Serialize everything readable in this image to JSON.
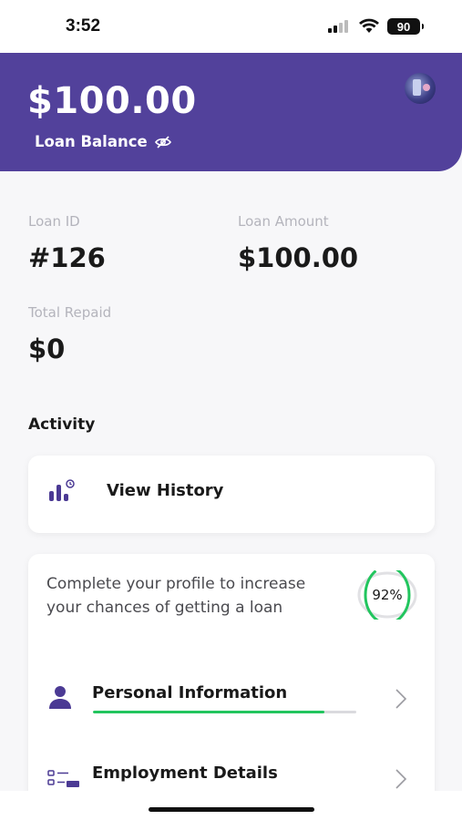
{
  "status_bar": {
    "time": "3:52",
    "battery": "90"
  },
  "header": {
    "balance": "$100.00",
    "balance_label": "Loan Balance"
  },
  "loan": {
    "id_label": "Loan ID",
    "id_value": "#126",
    "amount_label": "Loan Amount",
    "amount_value": "$100.00",
    "repaid_label": "Total Repaid",
    "repaid_value": "$0"
  },
  "activity": {
    "heading": "Activity",
    "history_label": "View History"
  },
  "profile": {
    "message": "Complete your profile to increase your chances of getting a loan",
    "progress_text": "92%",
    "progress_value": 0.92,
    "items": [
      {
        "label": "Personal Information",
        "progress": 0.88,
        "icon": "person-icon"
      },
      {
        "label": "Employment Details",
        "progress": null,
        "icon": "employment-icon"
      }
    ]
  },
  "colors": {
    "brand_purple": "#52419b",
    "progress_green": "#22c55e",
    "icon_purple": "#4b3a94"
  }
}
